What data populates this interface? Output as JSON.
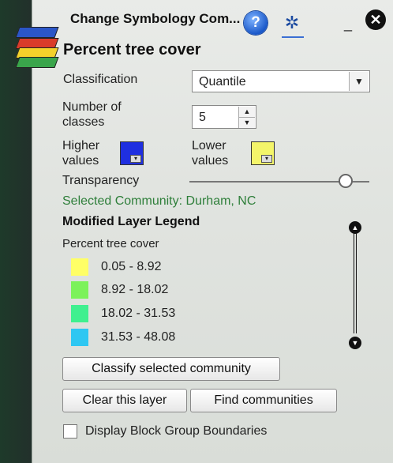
{
  "window": {
    "title": "Change Symbology Com...",
    "help_glyph": "?",
    "settings_glyph": "✲",
    "minimize_glyph": "_",
    "close_glyph": "✕"
  },
  "layer": {
    "title": "Percent tree cover"
  },
  "form": {
    "classification_label": "Classification",
    "classification_value": "Quantile",
    "classification_arrow": "▼",
    "num_classes_label": "Number of classes",
    "num_classes_value": "5",
    "spinner_up": "▲",
    "spinner_down": "▼",
    "higher_values_label": "Higher values",
    "lower_values_label": "Lower values",
    "higher_color": "#1f2fe0",
    "lower_color": "#f4f56a",
    "swatch_caret": "▾",
    "transparency_label": "Transparency",
    "transparency_fraction": 0.87
  },
  "community": {
    "selected_text": "Selected Community: Durham, NC"
  },
  "legend": {
    "heading": "Modified Layer Legend",
    "subheading": "Percent tree cover",
    "items": [
      {
        "label": "0.05 - 8.92",
        "color": "#ffff66"
      },
      {
        "label": "8.92 - 18.02",
        "color": "#7cf25a"
      },
      {
        "label": "18.02 - 31.53",
        "color": "#3ff08f"
      },
      {
        "label": "31.53 - 48.08",
        "color": "#2ec7f2"
      }
    ],
    "scroll_up_glyph": "▲",
    "scroll_down_glyph": "▼"
  },
  "buttons": {
    "classify_selected": "Classify selected community",
    "clear_layer": "Clear this layer",
    "find_communities": "Find communities"
  },
  "checkbox": {
    "label": "Display Block Group Boundaries",
    "checked": false
  },
  "icons": {
    "help": "help-icon",
    "settings": "settings-icon",
    "minimize": "minimize-icon",
    "close": "close-icon",
    "layers": "layers-stack-icon"
  }
}
